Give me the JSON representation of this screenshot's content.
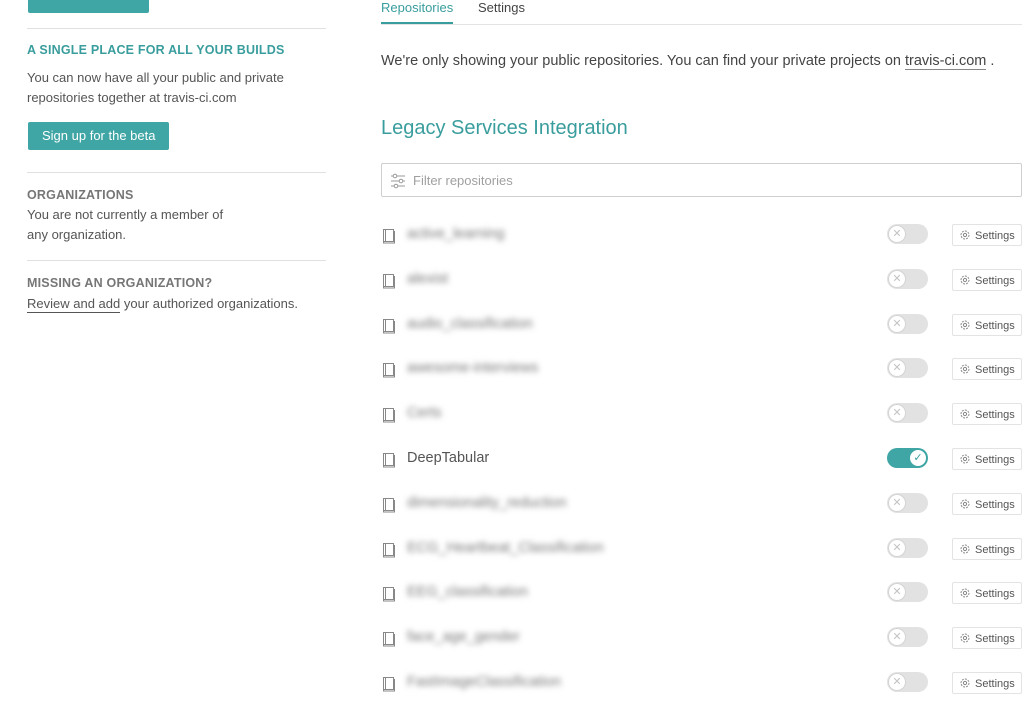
{
  "sidebar": {
    "builds_heading": "A SINGLE PLACE FOR ALL YOUR BUILDS",
    "builds_text_line1": "You can now have all your public and private",
    "builds_text_line2": "repositories together at travis-ci.com",
    "beta_button": "Sign up for the beta",
    "orgs_heading": "ORGANIZATIONS",
    "orgs_text_line1": "You are not currently a member of",
    "orgs_text_line2": "any organization.",
    "missing_heading": "MISSING AN ORGANIZATION?",
    "missing_link": "Review and add",
    "missing_text": " your authorized organizations."
  },
  "tabs": [
    {
      "label": "Repositories",
      "active": true
    },
    {
      "label": "Settings",
      "active": false
    }
  ],
  "notice": {
    "text": "We're only showing your public repositories. You can find your private projects on ",
    "link": "travis-ci.com",
    "suffix": " ."
  },
  "section_title": "Legacy Services Integration",
  "filter": {
    "placeholder": "Filter repositories",
    "value": ""
  },
  "repositories": [
    {
      "name": "active_learning",
      "enabled": false,
      "blurred": true
    },
    {
      "name": "alexist",
      "enabled": false,
      "blurred": true
    },
    {
      "name": "audio_classification",
      "enabled": false,
      "blurred": true
    },
    {
      "name": "awesome-interviews",
      "enabled": false,
      "blurred": true
    },
    {
      "name": "Certs",
      "enabled": false,
      "blurred": true
    },
    {
      "name": "DeepTabular",
      "enabled": true,
      "blurred": false
    },
    {
      "name": "dimensionality_reduction",
      "enabled": false,
      "blurred": true
    },
    {
      "name": "ECG_Heartbeat_Classification",
      "enabled": false,
      "blurred": true
    },
    {
      "name": "EEG_classification",
      "enabled": false,
      "blurred": true
    },
    {
      "name": "face_age_gender",
      "enabled": false,
      "blurred": true
    },
    {
      "name": "FastImageClassification",
      "enabled": false,
      "blurred": true
    }
  ],
  "settings_label": "Settings",
  "colors": {
    "accent": "#3fa5a5",
    "accent_text": "#3a9d9d",
    "divider": "#e0e0e0"
  }
}
